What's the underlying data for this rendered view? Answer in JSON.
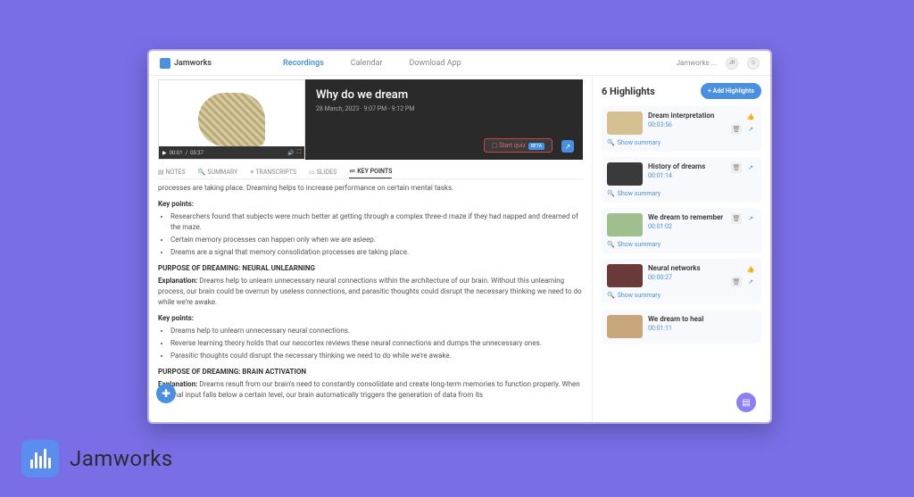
{
  "app": {
    "name": "Jamworks"
  },
  "nav": {
    "recordings": "Recordings",
    "calendar": "Calendar",
    "download": "Download App",
    "account": "Jamworks ...",
    "initials": "JR"
  },
  "video": {
    "title": "Why do we dream",
    "date": "28 March, 2023 · 9:07 PM - 9:12 PM",
    "current": "00:01",
    "duration": "05:37",
    "quiz": "Start quiz",
    "beta": "BETA"
  },
  "tabs": {
    "notes": "NOTES",
    "summary": "SUMMARY",
    "transcripts": "TRANSCRIPTS",
    "slides": "SLIDES",
    "keypoints": "KEY POINTS"
  },
  "doc": {
    "intro_frag": "processes are taking place. Dreaming helps to increase performance on certain mental tasks.",
    "kp_label": "Key points:",
    "kp1_1": "Researchers found that subjects were much better at getting through a complex three-d maze if they had napped and dreamed of the maze.",
    "kp1_2": "Certain memory processes can happen only when we are asleep.",
    "kp1_3": "Dreams are a signal that memory consolidation processes are taking place.",
    "h2": "PURPOSE OF DREAMING: NEURAL UNLEARNING",
    "exp_label": "Explanation:",
    "exp2": "Dreams help to unlearn unnecessary neural connections within the architecture of our brain. Without this unlearning process, our brain could be overrun by useless connections, and parasitic thoughts could disrupt the necessary thinking we need to do while we're awake.",
    "kp2_1": "Dreams help to unlearn unnecessary neural connections.",
    "kp2_2": "Reverse learning theory holds that our neocortex reviews these neural connections and dumps the unnecessary ones.",
    "kp2_3": "Parasitic thoughts could disrupt the necessary thinking we need to do while we're awake.",
    "h3": "PURPOSE OF DREAMING: BRAIN ACTIVATION",
    "exp3": "Dreams result from our brain's need to constantly consolidate and create long-term memories to function properly. When external input falls below a certain level, our brain automatically triggers the generation of data from its"
  },
  "sidebar": {
    "count_label": "6 Highlights",
    "add": "+  Add Highlights",
    "show_summary": "Show summary",
    "items": [
      {
        "title": "Dream interpretation",
        "time": "00:03:56"
      },
      {
        "title": "History of dreams",
        "time": "00:01:14"
      },
      {
        "title": "We dream to remember",
        "time": "00:01:02"
      },
      {
        "title": "Neural networks",
        "time": "00:00:27"
      },
      {
        "title": "We dream to heal",
        "time": "00:01:11"
      }
    ]
  },
  "footer": {
    "brand": "Jamworks"
  }
}
